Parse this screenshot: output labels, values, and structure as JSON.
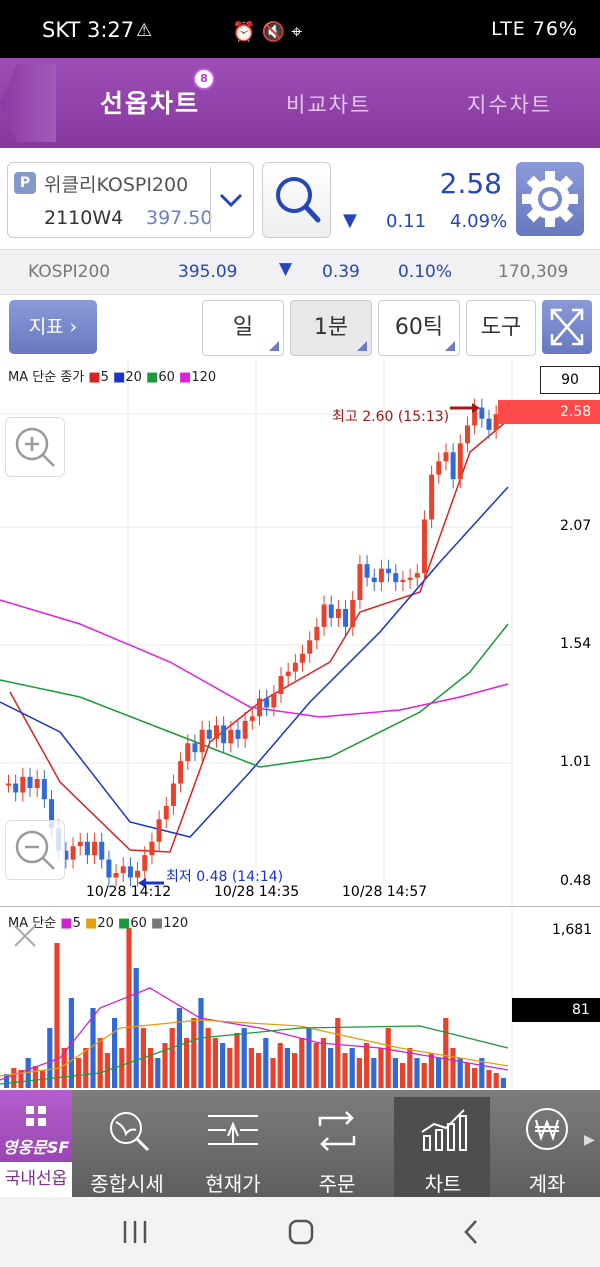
{
  "status_bar": {
    "carrier_time": "SKT 3:27",
    "indicators": "LTE 76%"
  },
  "header": {
    "tabs": [
      {
        "label": "선옵차트",
        "active": true
      },
      {
        "label": "비교차트",
        "active": false
      },
      {
        "label": "지수차트",
        "active": false
      }
    ],
    "badge": "8"
  },
  "product": {
    "badge": "P",
    "name": "위클리KOSPI200",
    "code": "2110W4",
    "price": "397.50",
    "current_price": "2.58",
    "change_arrow": "▼",
    "change": "0.11",
    "change_pct": "4.09%"
  },
  "index_row": {
    "name": "KOSPI200",
    "value": "395.09",
    "arrow": "▼",
    "change": "0.39",
    "pct": "0.10%",
    "volume": "170,309"
  },
  "toolbar": {
    "indicator_label": "지표 ›",
    "period_day": "일",
    "period_min": "1분",
    "period_tick": "60틱",
    "tools": "도구"
  },
  "main_chart": {
    "legend_title": "MA 단순 종가",
    "ma": [
      {
        "name": "5",
        "color": "#e02020"
      },
      {
        "name": "20",
        "color": "#1a33cc"
      },
      {
        "name": "60",
        "color": "#1a9a3a"
      },
      {
        "name": "120",
        "color": "#e020e0"
      }
    ],
    "top_box": "90",
    "price_tag": "2.58",
    "axis": [
      "2.07",
      "1.54",
      "1.01",
      "0.48"
    ],
    "high_label": "최고 2.60 (15:13)",
    "low_label": "최저 0.48 (14:14)",
    "x_labels": [
      "10/28 14:12",
      "10/28 14:35",
      "10/28 14:57"
    ]
  },
  "volume_chart": {
    "legend_title": "MA 단순",
    "ma": [
      {
        "name": "5",
        "color": "#d020d0"
      },
      {
        "name": "20",
        "color": "#e0a010"
      },
      {
        "name": "60",
        "color": "#1a9a3a"
      },
      {
        "name": "120",
        "color": "#777777"
      }
    ],
    "max_label": "1,681",
    "tag": "81"
  },
  "nav": {
    "brand": "영웅문SF",
    "items": [
      {
        "label": "국내선옵"
      },
      {
        "label": "종합시세"
      },
      {
        "label": "현재가"
      },
      {
        "label": "주문"
      },
      {
        "label": "차트"
      },
      {
        "label": "계좌"
      }
    ]
  }
}
